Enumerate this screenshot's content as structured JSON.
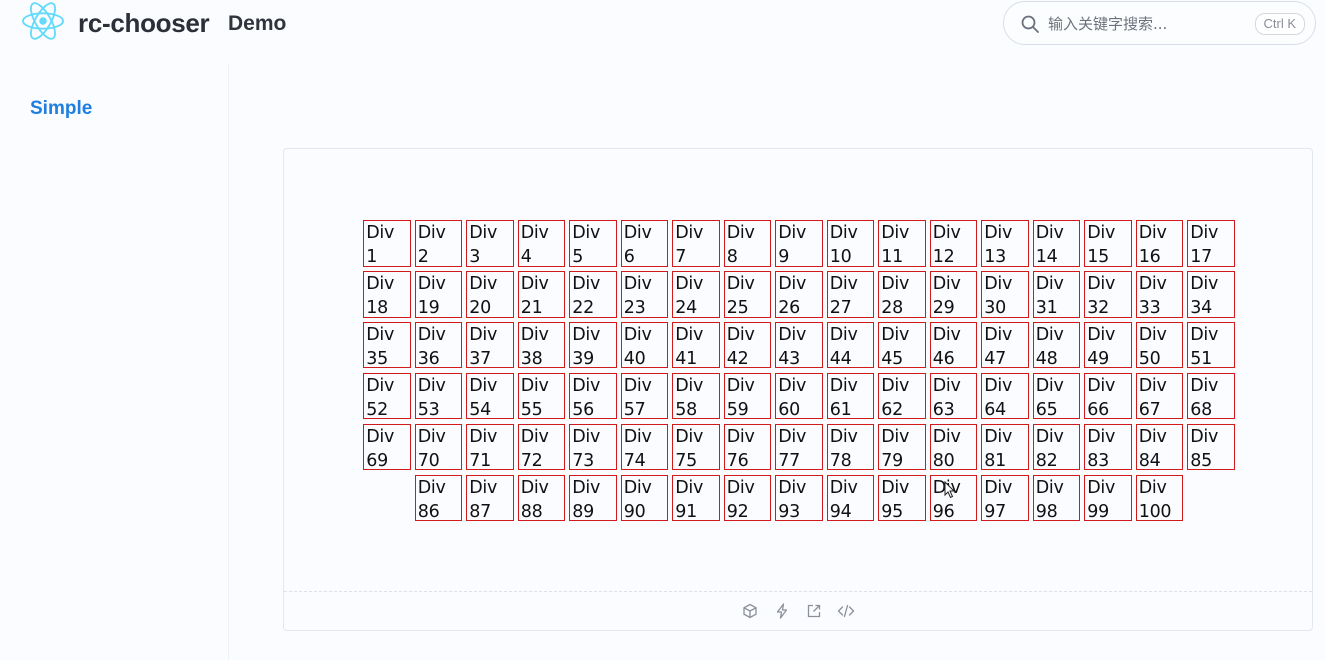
{
  "header": {
    "brand": "rc-chooser",
    "nav_demo": "Demo",
    "search": {
      "placeholder": "输入关键字搜索...",
      "value": "",
      "shortcut": "Ctrl K"
    }
  },
  "sidebar": {
    "items": [
      {
        "label": "Simple",
        "active": true
      }
    ]
  },
  "demo": {
    "box_prefix": "Div",
    "box_count": 100,
    "actions": [
      {
        "name": "codesandbox-icon"
      },
      {
        "name": "stackblitz-icon"
      },
      {
        "name": "open-external-icon"
      },
      {
        "name": "show-code-icon"
      }
    ]
  },
  "colors": {
    "accent": "#1e7fe0",
    "box_border": "#d11a1a",
    "logo": "#61dafb"
  }
}
